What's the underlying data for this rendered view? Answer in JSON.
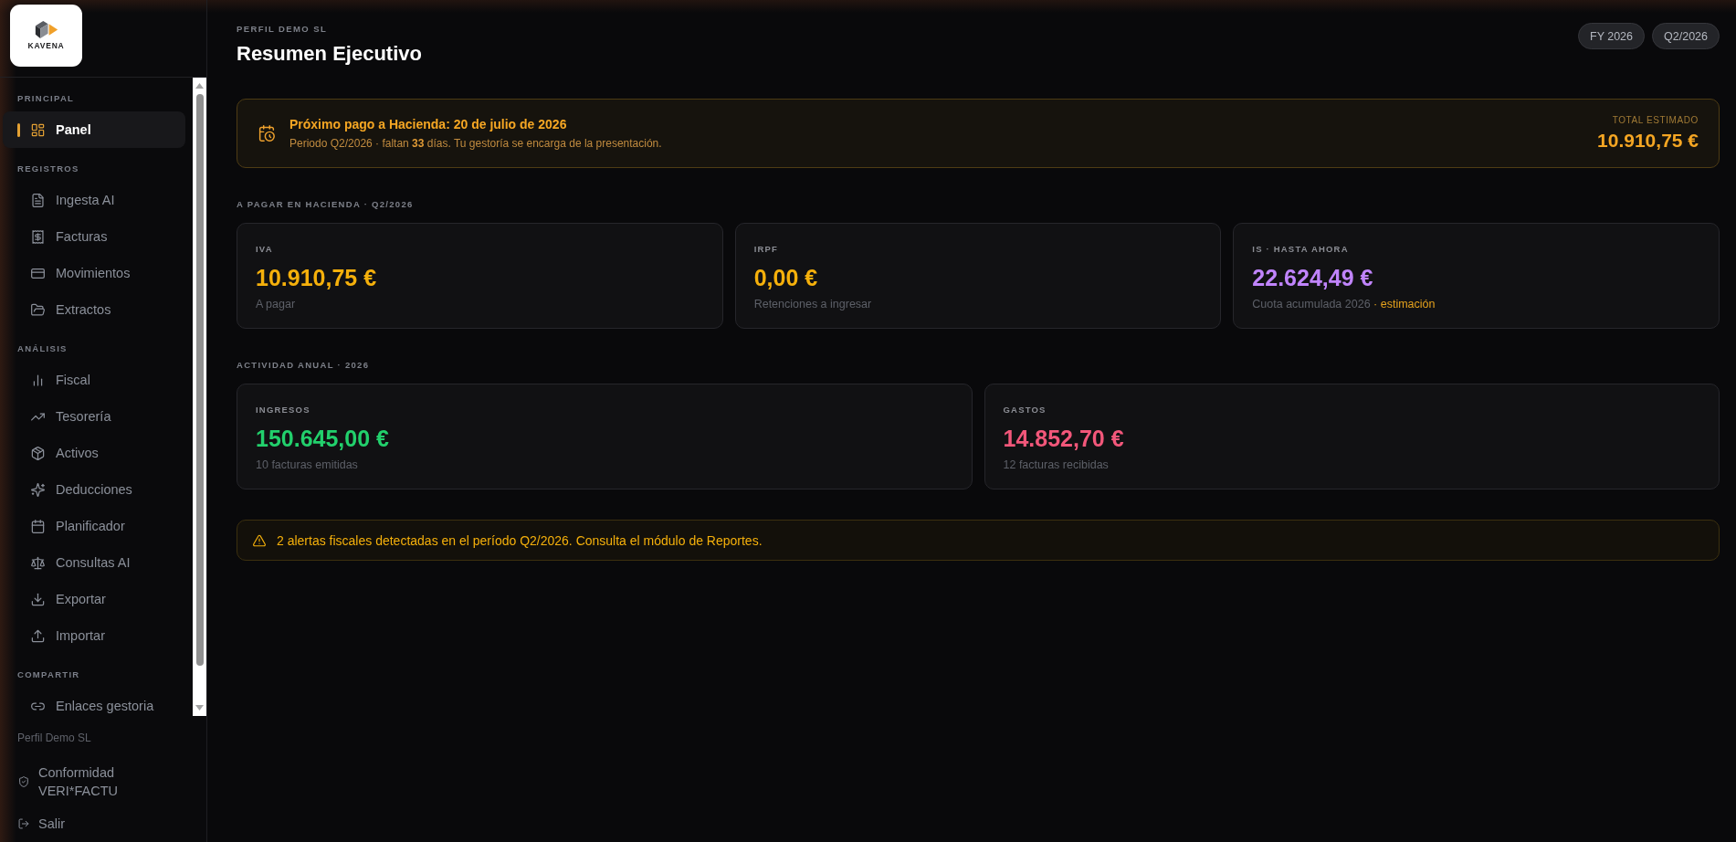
{
  "sidebar": {
    "logo": {
      "text": "KAVENA"
    },
    "sections": [
      {
        "label": "PRINCIPAL",
        "items": [
          {
            "label": "Panel",
            "selected": true
          }
        ]
      },
      {
        "label": "REGISTROS",
        "items": [
          {
            "label": "Ingesta AI",
            "selected": false
          },
          {
            "label": "Facturas",
            "selected": false
          },
          {
            "label": "Movimientos",
            "selected": false
          },
          {
            "label": "Extractos",
            "selected": false
          }
        ]
      },
      {
        "label": "ANÁLISIS",
        "items": [
          {
            "label": "Fiscal",
            "selected": false
          },
          {
            "label": "Tesorería",
            "selected": false
          },
          {
            "label": "Activos",
            "selected": false
          },
          {
            "label": "Deducciones",
            "selected": false
          },
          {
            "label": "Planificador",
            "selected": false
          },
          {
            "label": "Consultas AI",
            "selected": false
          },
          {
            "label": "Exportar",
            "selected": false
          },
          {
            "label": "Importar",
            "selected": false
          }
        ]
      },
      {
        "label": "COMPARTIR",
        "items": [
          {
            "label": "Enlaces gestoria",
            "selected": false
          }
        ]
      }
    ],
    "footer": {
      "profile": "Perfil Demo SL",
      "links": [
        "Conformidad VERI*FACTU",
        "Salir"
      ]
    }
  },
  "header": {
    "eyebrow": "PERFIL DEMO SL",
    "title": "Resumen Ejecutivo",
    "periods": [
      "FY 2026",
      "Q2/2026"
    ]
  },
  "payment_banner": {
    "title": "Próximo pago a Hacienda: 20 de julio de 2026",
    "subtitle": "Periodo Q2/2026 · faltan **33** días. Tu gestoría se encarga de la presentación.",
    "total_label": "TOTAL ESTIMADO",
    "total": "10.910,75 €"
  },
  "tax_section": {
    "label": "A PAGAR EN HACIENDA · Q2/2026",
    "cards": [
      {
        "label": "IVA",
        "value": "10.910,75 €",
        "note": "A pagar",
        "color": "#f5b00b"
      },
      {
        "label": "IRPF",
        "value": "0,00 €",
        "note": "Retenciones a ingresar",
        "color": "#f5b00b"
      },
      {
        "label": "IS · HASTA AHORA",
        "value": "22.624,49 €",
        "note": "Cuota acumulada 2026",
        "note_highlight": "· estimación",
        "color": "#c084fc"
      }
    ]
  },
  "activity_section": {
    "label": "ACTIVIDAD ANUAL · 2026",
    "cards": [
      {
        "label": "INGRESOS",
        "value": "150.645,00 €",
        "note": "10 facturas emitidas",
        "color": "#22d06c"
      },
      {
        "label": "GASTOS",
        "value": "14.852,70 €",
        "note": "12 facturas recibidas",
        "color": "#f2577a"
      }
    ]
  },
  "alert": {
    "text": "2 alertas fiscales detectadas en el período Q2/2026. Consulta el módulo de Reportes."
  }
}
